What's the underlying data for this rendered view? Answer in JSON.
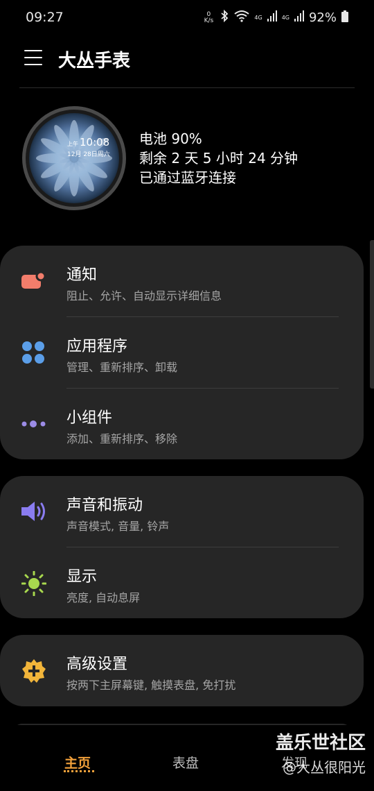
{
  "status_bar": {
    "time": "09:27",
    "net_speed_top": "0",
    "net_speed_unit": "K/s",
    "signal_1": "4G",
    "signal_2": "4G",
    "battery": "92%"
  },
  "app_bar": {
    "title": "大丛手表"
  },
  "watch": {
    "face_ampm": "上午",
    "face_time": "10:08",
    "face_date": "12月 28日周六",
    "battery": "电池 90%",
    "remaining": "剩余 2 天 5 小时 24 分钟",
    "connection": "已通过蓝牙连接"
  },
  "cards": [
    {
      "items": [
        {
          "title": "通知",
          "subtitle": "阻止、允许、自动显示详细信息",
          "icon": "notification-icon",
          "color": "#f27d6b"
        },
        {
          "title": "应用程序",
          "subtitle": "管理、重新排序、卸载",
          "icon": "apps-icon",
          "color": "#5b9ee8"
        },
        {
          "title": "小组件",
          "subtitle": "添加、重新排序、移除",
          "icon": "widgets-icon",
          "color": "#9c8ce6"
        }
      ]
    },
    {
      "items": [
        {
          "title": "声音和振动",
          "subtitle": "声音模式, 音量, 铃声",
          "icon": "sound-icon",
          "color": "#8a7cf0"
        },
        {
          "title": "显示",
          "subtitle": "亮度, 自动息屏",
          "icon": "brightness-icon",
          "color": "#a8d84e"
        }
      ]
    },
    {
      "items": [
        {
          "title": "高级设置",
          "subtitle": "按两下主屏幕键, 触摸表盘, 免打扰",
          "icon": "advanced-settings-icon",
          "color": "#f2b53a"
        }
      ]
    }
  ],
  "bottom_nav": {
    "home": "主页",
    "faces": "表盘",
    "discover": "发现"
  },
  "watermark": {
    "line1": "盖乐世社区",
    "line2": "@大丛很阳光"
  }
}
